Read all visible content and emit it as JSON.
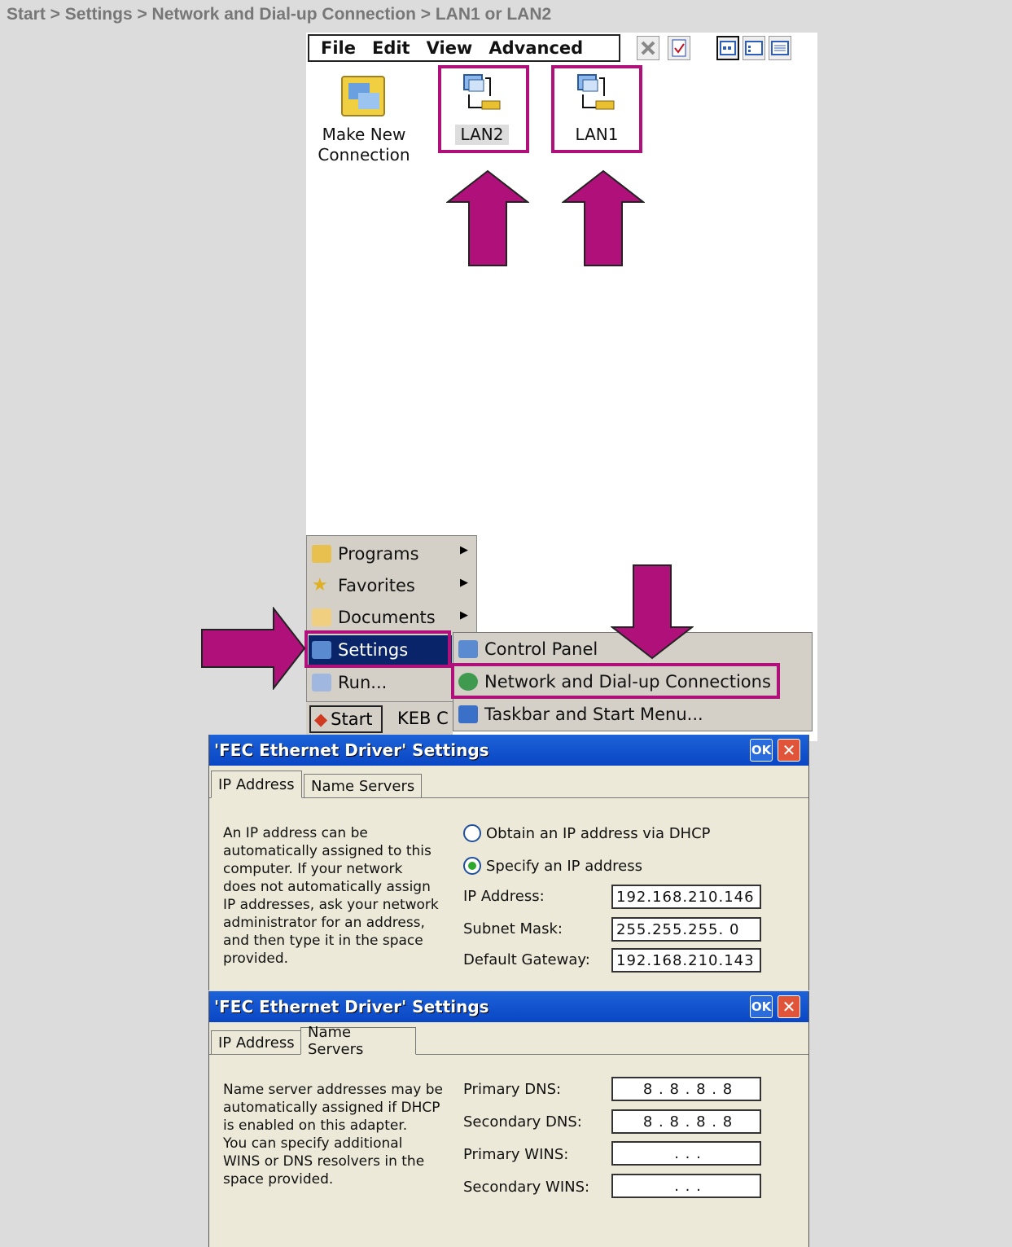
{
  "breadcrumb": "Start > Settings > Network and Dial-up Connection > LAN1 or LAN2",
  "menubar": {
    "file": "File",
    "edit": "Edit",
    "view": "View",
    "advanced": "Advanced"
  },
  "connections": {
    "make_new_line1": "Make New",
    "make_new_line2": "Connection",
    "lan2": "LAN2",
    "lan1": "LAN1"
  },
  "start_menu": {
    "items": [
      {
        "label": "Programs"
      },
      {
        "label": "Favorites"
      },
      {
        "label": "Documents"
      },
      {
        "label": "Settings"
      },
      {
        "label": "Run..."
      }
    ]
  },
  "settings_submenu": {
    "items": [
      {
        "label": "Control Panel"
      },
      {
        "label": "Network and Dial-up Connections"
      },
      {
        "label": "Taskbar and Start Menu..."
      }
    ]
  },
  "taskbar": {
    "start": "Start",
    "task": "KEB C"
  },
  "dialog1": {
    "title": "'FEC Ethernet Driver' Settings",
    "ok": "OK",
    "tabs": [
      "IP Address",
      "Name Servers"
    ],
    "description": [
      "An IP address can be",
      "automatically assigned to this",
      "computer.  If your network",
      "does not automatically assign",
      "IP addresses, ask your network",
      "administrator for an address,",
      "and then type it in the space",
      "provided."
    ],
    "radio_dhcp": "Obtain an IP address via DHCP",
    "radio_specify": "Specify an IP address",
    "ip_label": "IP Address:",
    "ip_value": "192.168.210.146",
    "mask_label": "Subnet Mask:",
    "mask_value": "255.255.255. 0",
    "gw_label": "Default Gateway:",
    "gw_value": "192.168.210.143"
  },
  "dialog2": {
    "title": "'FEC Ethernet Driver' Settings",
    "ok": "OK",
    "tabs": [
      "IP Address",
      "Name Servers"
    ],
    "description": [
      "Name server addresses may be",
      "automatically assigned if DHCP",
      "is enabled on this adapter.",
      "You can specify additional",
      "WINS or DNS resolvers in the",
      "space provided."
    ],
    "pdns_label": "Primary DNS:",
    "pdns_value": "8 . 8 . 8 . 8",
    "sdns_label": "Secondary DNS:",
    "sdns_value": "8 . 8 . 8 . 8",
    "pwins_label": "Primary WINS:",
    "pwins_value": ".     .     .",
    "swins_label": "Secondary WINS:",
    "swins_value": ".     .     ."
  },
  "colors": {
    "highlight": "#b0107a",
    "titlebar": "#0a46c4",
    "menu_selected": "#0a246a"
  }
}
